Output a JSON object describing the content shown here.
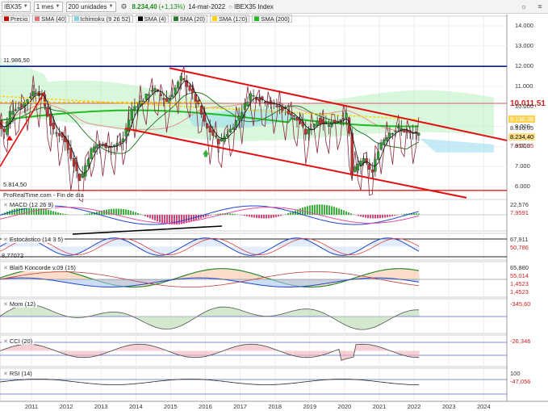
{
  "toolbar": {
    "symbol": "IBX35",
    "interval": "1 mes",
    "units": "200 unidades",
    "price": "8.234,40",
    "change": "(+1,13%)",
    "date": "14-mar-2022",
    "instrument": "IBEX35 Index"
  },
  "legend": [
    {
      "label": "Precio",
      "color": "#cc0000"
    },
    {
      "label": "SMA (40)",
      "color": "#e07070"
    },
    {
      "label": "Ichimoku (9 26 52)",
      "color": "#7fd4e8"
    },
    {
      "label": "SMA (4)",
      "color": "#000000"
    },
    {
      "label": "SMA (20)",
      "color": "#2a7a2a"
    },
    {
      "label": "SMA (120)",
      "color": "#ffd200"
    },
    {
      "label": "SMA (200)",
      "color": "#22bb22"
    }
  ],
  "price_pane": {
    "source_label": "ProRealTime.com - Fin de día",
    "high_label": "11.986,50",
    "low_label": "5.814,50",
    "tags": [
      {
        "text": "10.011,51",
        "color": "#cc2222",
        "bg": "#ffffff"
      },
      {
        "text": "9.138,38",
        "color": "#ffffff",
        "bg": "#ffd24a"
      },
      {
        "text": "8.510,05",
        "color": "#333333",
        "bg": "#ffffff"
      },
      {
        "text": "8.234,40",
        "color": "#000000",
        "bg": "#ffe08a"
      },
      {
        "text": "7.957,35",
        "color": "#cc2222",
        "bg": "#ffffff"
      }
    ],
    "axis": [
      "14.000",
      "13.000",
      "12.000",
      "11.000",
      "10.000",
      "9.000",
      "8.000",
      "7.000",
      "6.000"
    ]
  },
  "indicators": [
    {
      "label": "MACD (12 26 9)",
      "values": [
        "22,576",
        "7,9591"
      ]
    },
    {
      "label": "Estocástico (14 3 5)",
      "values": [
        "67,911",
        "50,786"
      ],
      "left_value": "8,77072"
    },
    {
      "label": "Blai5 Koncorde v.09 (15)",
      "values": [
        "65,880",
        "55,014",
        "1,4523",
        "1,4523"
      ]
    },
    {
      "label": "Mom (12)",
      "values": [
        "-345,60"
      ]
    },
    {
      "label": "CCI (20)",
      "values": [
        "-26,346"
      ]
    },
    {
      "label": "RSI (14)",
      "values": [
        "100",
        "-47,056"
      ]
    }
  ],
  "x_axis": [
    "2011",
    "2012",
    "2013",
    "2014",
    "2015",
    "2016",
    "2017",
    "2018",
    "2019",
    "2020",
    "2021",
    "2022",
    "2023",
    "2024"
  ]
}
